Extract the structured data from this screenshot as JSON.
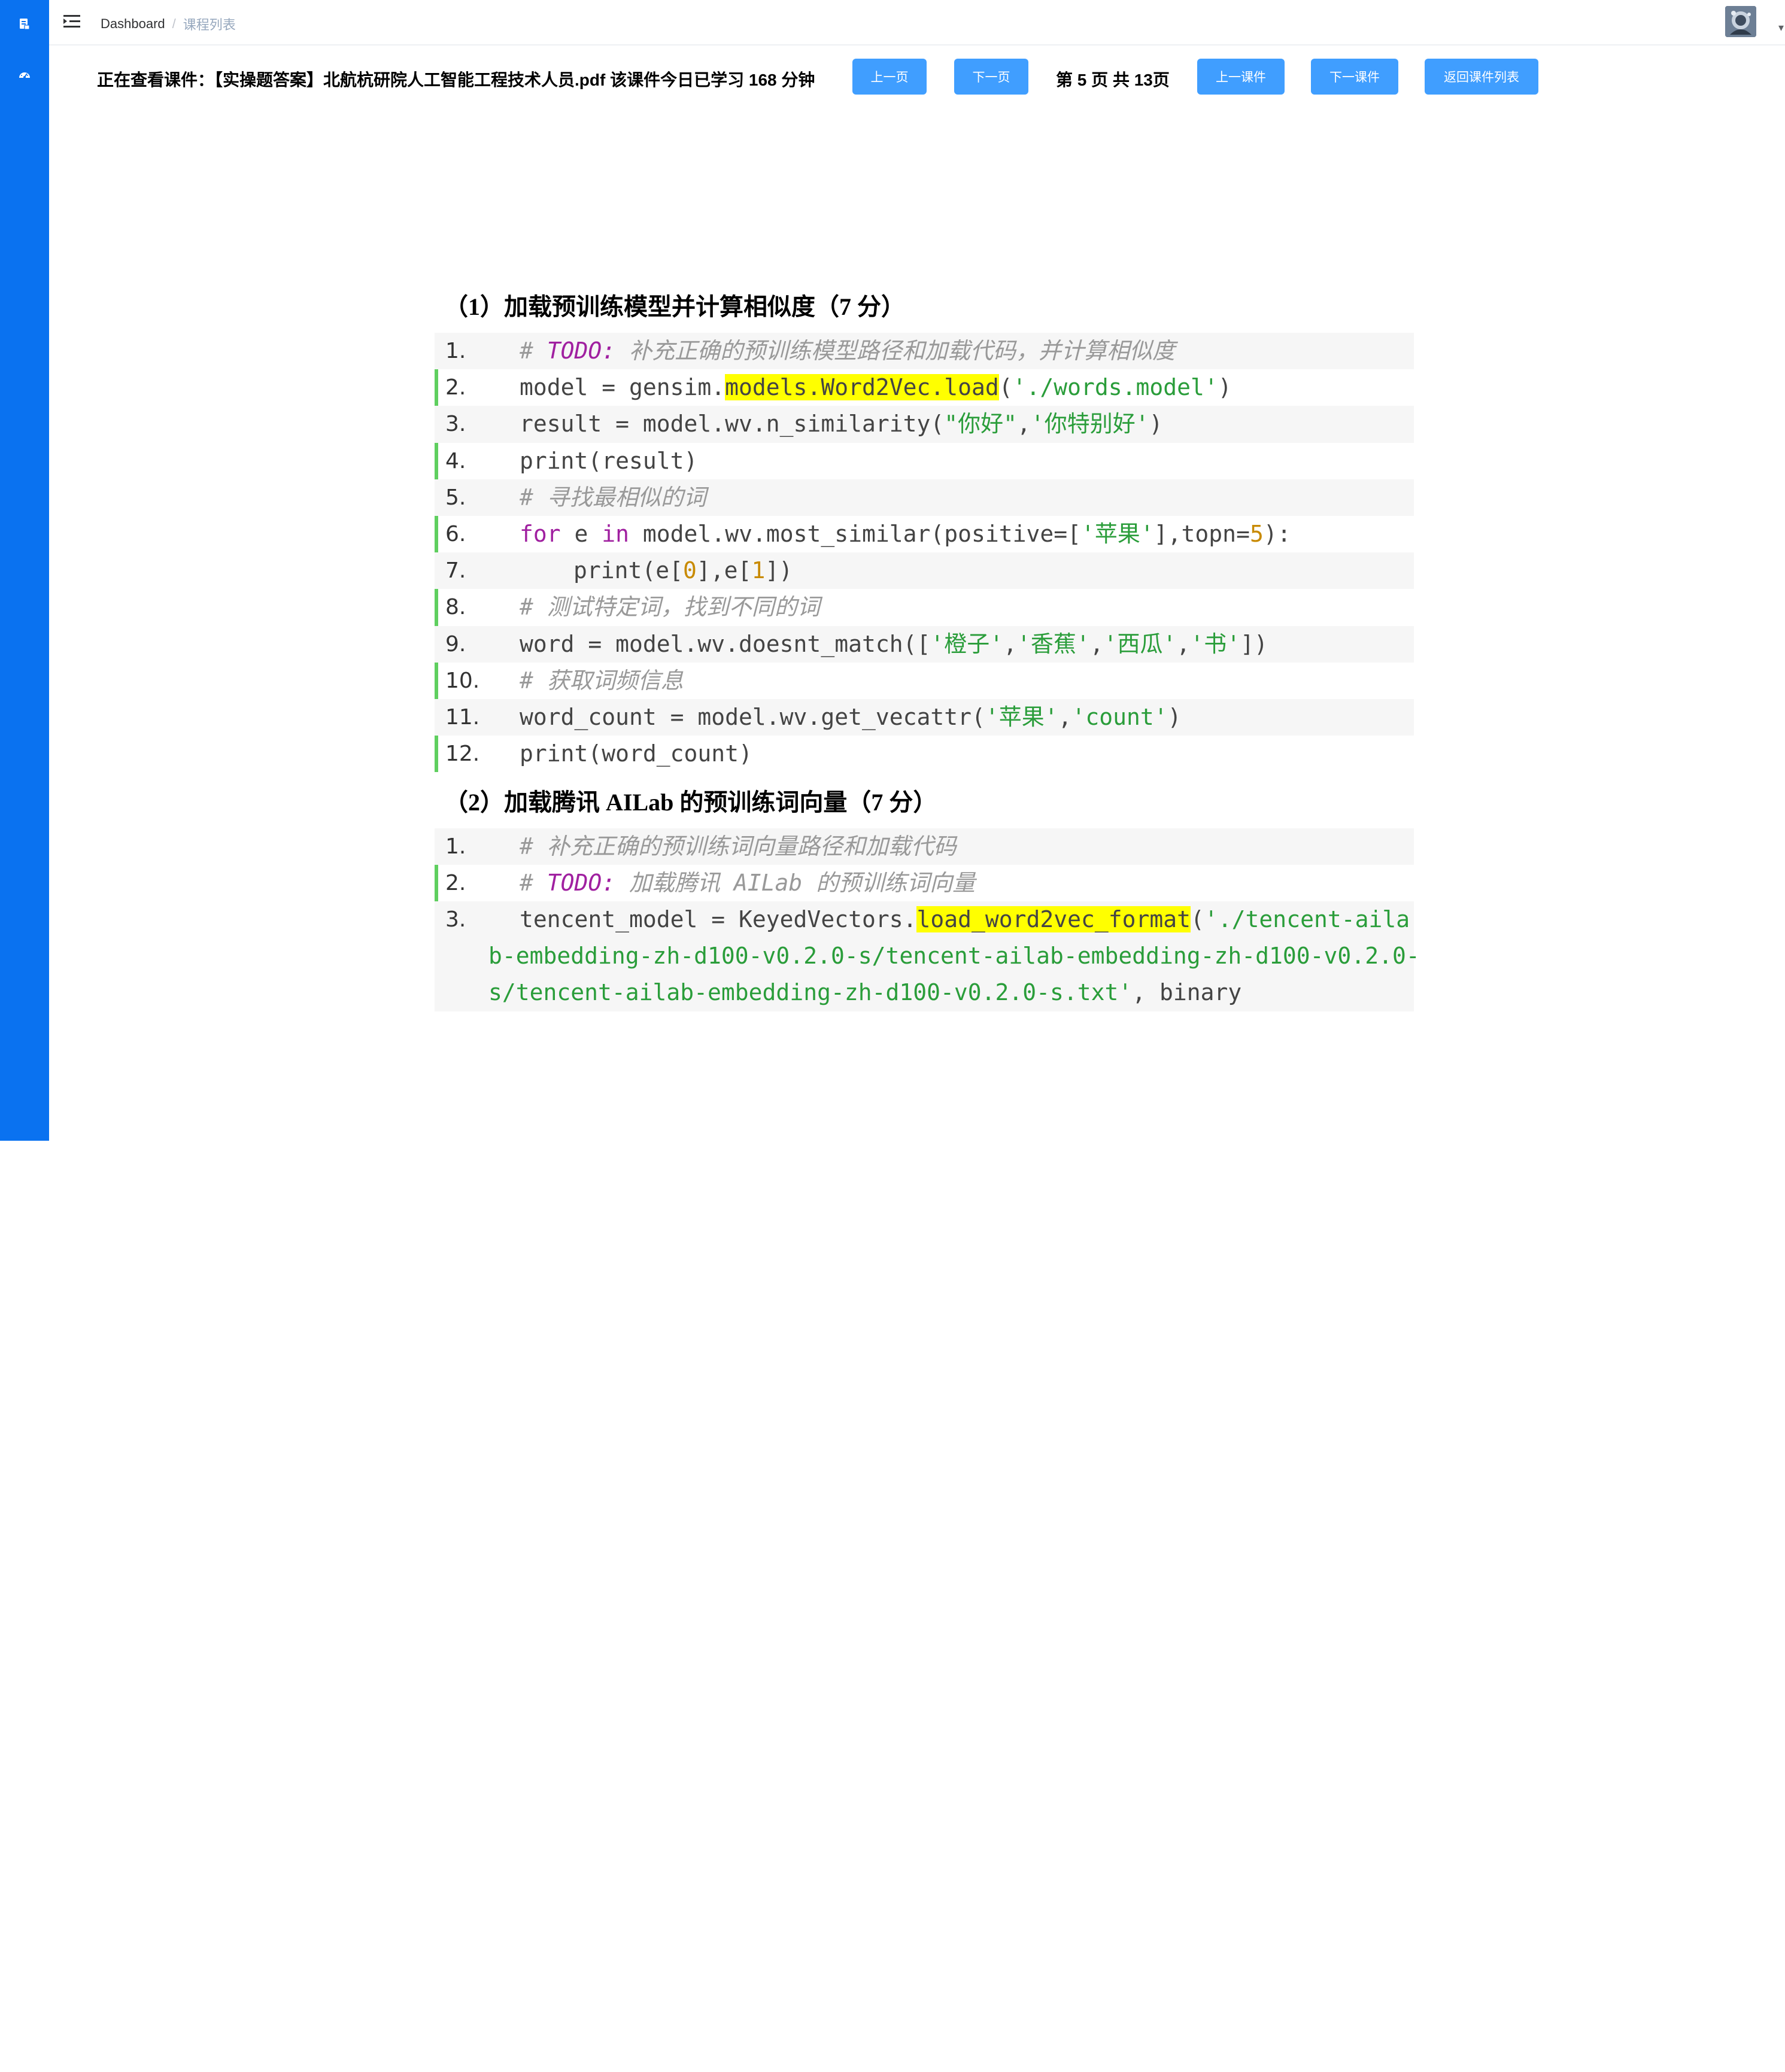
{
  "sidebar": {
    "icons": [
      "document-icon",
      "dashboard-icon"
    ]
  },
  "header": {
    "breadcrumb": {
      "home": "Dashboard",
      "separator": "/",
      "current": "课程列表"
    }
  },
  "toolbar": {
    "viewing_text": "正在查看课件：【实操题答案】北航杭研院人工智能工程技术人员.pdf 该课件今日已学习 168 分钟",
    "prev_page": "上一页",
    "next_page": "下一页",
    "page_info": "第 5 页 共 13页",
    "prev_courseware": "上一课件",
    "next_courseware": "下一课件",
    "back_to_list": "返回课件列表"
  },
  "document": {
    "q1_title": "（1）加载预训练模型并计算相似度（7 分）",
    "q2_title": "（2）加载腾讯 AILab 的预训练词向量（7 分）",
    "block1": {
      "numbers": [
        "1.",
        "2.",
        "3.",
        "4.",
        "5.",
        "6.",
        "7.",
        "8.",
        "9.",
        "10.",
        "11.",
        "12."
      ],
      "l1_hash": "# ",
      "l1_todo": "TODO:",
      "l1_comment": " 补充正确的预训练模型路径和加载代码，并计算相似度",
      "l2_a": "model = gensim.",
      "l2_hl": "models.Word2Vec.load",
      "l2_b": "(",
      "l2_str": "'./words.model'",
      "l2_c": ")",
      "l3_a": "result = model.wv.n_similarity(",
      "l3_s1": "\"你好\"",
      "l3_b": ",",
      "l3_s2": "'你特别好'",
      "l3_c": ")",
      "l4": "print(result)",
      "l5": "# 寻找最相似的词",
      "l6_for": "for",
      "l6_a": " e ",
      "l6_in": "in",
      "l6_b": " model.wv.most_similar(positive=[",
      "l6_s": "'苹果'",
      "l6_c": "],topn=",
      "l6_n": "5",
      "l6_d": "):",
      "l7_a": "print(e[",
      "l7_n1": "0",
      "l7_b": "],e[",
      "l7_n2": "1",
      "l7_c": "])",
      "l8": "# 测试特定词，找到不同的词",
      "l9_a": "word = model.wv.doesnt_match([",
      "l9_s1": "'橙子'",
      "l9_c1": ",",
      "l9_s2": "'香蕉'",
      "l9_c2": ",",
      "l9_s3": "'西瓜'",
      "l9_c3": ",",
      "l9_s4": "'书'",
      "l9_b": "])",
      "l10": "# 获取词频信息",
      "l11_a": "word_count = model.wv.get_vecattr(",
      "l11_s1": "'苹果'",
      "l11_b": ",",
      "l11_s2": "'count'",
      "l11_c": ")",
      "l12": "print(word_count)"
    },
    "block2": {
      "numbers": [
        "1.",
        "2.",
        "3."
      ],
      "l1": "# 补充正确的预训练词向量路径和加载代码",
      "l2_hash": "# ",
      "l2_todo": "TODO:",
      "l2_comment": " 加载腾讯 AILab 的预训练词向量",
      "l3_a": "tencent_model = KeyedVectors.",
      "l3_hl": "load_word2vec_format",
      "l3_b": "(",
      "l3_str1": "'./tencent-aila",
      "l3_str2": "b-embedding-zh-d100-v0.2.0-s/tencent-ailab-embedding-zh-d100-v0.2.0-",
      "l3_str3": "s/tencent-ailab-embedding-zh-d100-v0.2.0-s.txt'",
      "l3_tail": ", binary"
    }
  }
}
